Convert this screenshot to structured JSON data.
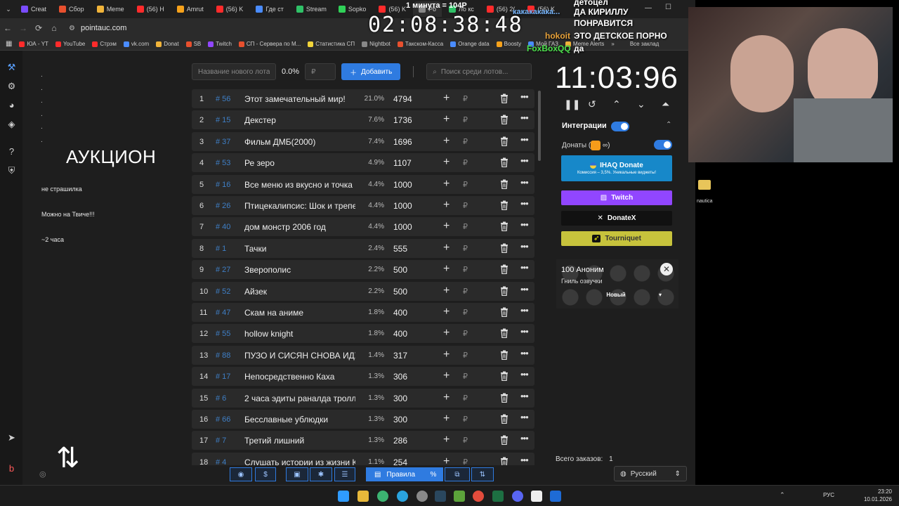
{
  "browser": {
    "tabs": [
      {
        "label": "Creat",
        "color": "#7a4cff"
      },
      {
        "label": "Сбор",
        "color": "#e8502e"
      },
      {
        "label": "Meme",
        "color": "#f1b43a"
      },
      {
        "label": "(56) H",
        "color": "#ff2b2b"
      },
      {
        "label": "Amrut",
        "color": "#f7a21b"
      },
      {
        "label": "(56) K",
        "color": "#ff2b2b"
      },
      {
        "label": "Где ст",
        "color": "#4a8cff"
      },
      {
        "label": "Stream",
        "color": "#2fc167"
      },
      {
        "label": "Sopko",
        "color": "#30d158"
      },
      {
        "label": "(56) K",
        "color": "#ff2b2b"
      },
      {
        "label": "Po",
        "color": "#888888"
      },
      {
        "label": "Ло кс",
        "color": "#2fc167"
      },
      {
        "label": "(56) 2(",
        "color": "#ff2b2b"
      },
      {
        "label": "(56) K",
        "color": "#ff2b2b"
      }
    ],
    "url": "pointauc.com",
    "bookmarks": [
      {
        "label": "ЮА - YT",
        "color": "#ff2b2b"
      },
      {
        "label": "YouTube",
        "color": "#ff2b2b"
      },
      {
        "label": "Стрэм",
        "color": "#ff2b2b"
      },
      {
        "label": "vk.com",
        "color": "#4a8cff"
      },
      {
        "label": "Donat",
        "color": "#f1b43a"
      },
      {
        "label": "SB",
        "color": "#e8502e"
      },
      {
        "label": "Twitch",
        "color": "#9147ff"
      },
      {
        "label": "СП - Сервера по М...",
        "color": "#e8502e"
      },
      {
        "label": "Статистика СП",
        "color": "#f1d43a"
      },
      {
        "label": "Nightbot",
        "color": "#888888"
      },
      {
        "label": "Такском-Касса",
        "color": "#e8502e"
      },
      {
        "label": "Orange data",
        "color": "#4a8cff"
      },
      {
        "label": "Boosty",
        "color": "#f7a21b"
      },
      {
        "label": "Мой ГАЗ",
        "color": "#4a8cff"
      },
      {
        "label": "Meme Alerts",
        "color": "#f1b43a"
      }
    ],
    "all_bookmarks": "Все заклад"
  },
  "stream_overlay": {
    "big_clock": "02:08:38:48",
    "minute_price": "1 минута = 104Р",
    "chat": [
      {
        "user": "",
        "text": "детоцел"
      },
      {
        "user": "какакакака...",
        "text": "ДА КИРИЛЛУ"
      },
      {
        "user": "",
        "text": "ПОНРАВИТСЯ"
      },
      {
        "user": "hokoit",
        "text": "ЭТО ДЕТСКОЕ ПОРНО"
      },
      {
        "user": "FoxBoxQQ",
        "text": "да"
      }
    ]
  },
  "page": {
    "left_dots": [
      ".",
      ".",
      ".",
      ".",
      ".",
      "."
    ],
    "auction_title": "АУКЦИОН",
    "notes": [
      "не страшилка",
      "Можно на  Твиче!!!",
      "~2 часа"
    ],
    "toolbar": {
      "new_lot_placeholder": "Название нового лота",
      "percent": "0.0%",
      "currency_placeholder": "₽",
      "add_label": "Добавить",
      "search_placeholder": "Поиск среди лотов..."
    },
    "lots": [
      {
        "rank": "1",
        "id": "# 56",
        "name": "Этот замечательный мир!",
        "percent": "21.0%",
        "amount": "4794"
      },
      {
        "rank": "2",
        "id": "# 15",
        "name": "Декстер",
        "percent": "7.6%",
        "amount": "1736"
      },
      {
        "rank": "3",
        "id": "# 37",
        "name": "Фильм ДМБ(2000)",
        "percent": "7.4%",
        "amount": "1696"
      },
      {
        "rank": "4",
        "id": "# 53",
        "name": "Ре зеро",
        "percent": "4.9%",
        "amount": "1107"
      },
      {
        "rank": "5",
        "id": "# 16",
        "name": "Все меню из вкусно и точка",
        "percent": "4.4%",
        "amount": "1000"
      },
      {
        "rank": "6",
        "id": "# 26",
        "name": "Птицекалипсис: Шок и трепе",
        "percent": "4.4%",
        "amount": "1000"
      },
      {
        "rank": "7",
        "id": "# 40",
        "name": "дом монстр 2006 год",
        "percent": "4.4%",
        "amount": "1000"
      },
      {
        "rank": "8",
        "id": "# 1",
        "name": "Тачки",
        "percent": "2.4%",
        "amount": "555"
      },
      {
        "rank": "9",
        "id": "# 27",
        "name": "Зверополис",
        "percent": "2.2%",
        "amount": "500"
      },
      {
        "rank": "10",
        "id": "# 52",
        "name": "Айзек",
        "percent": "2.2%",
        "amount": "500"
      },
      {
        "rank": "11",
        "id": "# 47",
        "name": "Скам на аниме",
        "percent": "1.8%",
        "amount": "400"
      },
      {
        "rank": "12",
        "id": "# 55",
        "name": "hollow knight",
        "percent": "1.8%",
        "amount": "400"
      },
      {
        "rank": "13",
        "id": "# 88",
        "name": "ПУЗО И СИСЯН СНОВА ИДУ",
        "percent": "1.4%",
        "amount": "317"
      },
      {
        "rank": "14",
        "id": "# 17",
        "name": "Непосредственно Каха",
        "percent": "1.3%",
        "amount": "306"
      },
      {
        "rank": "15",
        "id": "# 6",
        "name": "2 часа эдиты раналда тролл",
        "percent": "1.3%",
        "amount": "300"
      },
      {
        "rank": "16",
        "id": "# 66",
        "name": "Бесславные ублюдки",
        "percent": "1.3%",
        "amount": "300"
      },
      {
        "rank": "17",
        "id": "# 7",
        "name": "Третий лишний",
        "percent": "1.3%",
        "amount": "286"
      },
      {
        "rank": "18",
        "id": "# 4",
        "name": "Слушать истории из жизни Ка",
        "percent": "1.1%",
        "amount": "254"
      }
    ],
    "currency_symbol": "₽",
    "timer": "11:03:96",
    "integrations_label": "Интеграции",
    "donations_label": "Донаты (",
    "donations_suffix": ")",
    "services": {
      "ihaq": "IHAQ Donate",
      "ihaq_sub": "Комиссия – 3,5%. Уникальные виджеты!",
      "twitch": "Twitch",
      "donatex": "DonateX",
      "tourniquet": "Tourniquet"
    },
    "donor": {
      "amount_name": "100 Аноним",
      "message": "Гниль озвучки",
      "status": "Новый"
    },
    "orders_label": "Всего заказов:",
    "orders_count": "1",
    "language": "Русский",
    "bottom_toolbar": {
      "rules": "Правила",
      "percent": "%"
    }
  },
  "desktop": {
    "folder_label": "nautica",
    "tray": {
      "lang": "РУС",
      "time": "23:20",
      "date": "10.01.2026"
    }
  }
}
